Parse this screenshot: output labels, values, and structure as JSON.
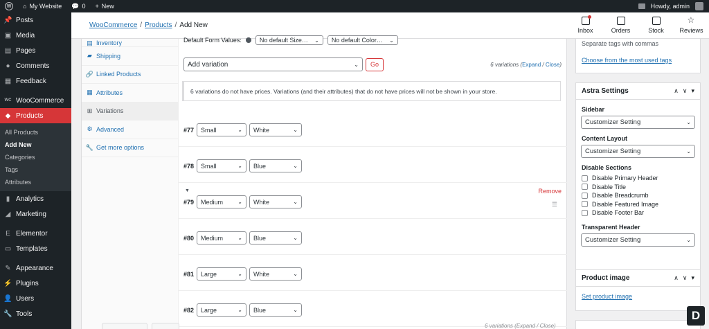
{
  "adminbar": {
    "site_name": "My Website",
    "comments_count": "0",
    "new_label": "New",
    "howdy": "Howdy, admin"
  },
  "sidebar": {
    "items_top": [
      {
        "label": "Posts",
        "icon": "pin-icon"
      },
      {
        "label": "Media",
        "icon": "media-icon"
      },
      {
        "label": "Pages",
        "icon": "pages-icon"
      },
      {
        "label": "Comments",
        "icon": "comments-icon"
      },
      {
        "label": "Feedback",
        "icon": "feedback-icon"
      }
    ],
    "woocommerce": "WooCommerce",
    "products": "Products",
    "submenu": [
      "All Products",
      "Add New",
      "Categories",
      "Tags",
      "Attributes"
    ],
    "items_bottom": [
      {
        "label": "Analytics",
        "icon": "analytics-icon"
      },
      {
        "label": "Marketing",
        "icon": "marketing-icon"
      },
      {
        "label": "Elementor",
        "icon": "elementor-icon"
      },
      {
        "label": "Templates",
        "icon": "templates-icon"
      },
      {
        "label": "Appearance",
        "icon": "appearance-icon"
      },
      {
        "label": "Plugins",
        "icon": "plugins-icon"
      },
      {
        "label": "Users",
        "icon": "users-icon"
      },
      {
        "label": "Tools",
        "icon": "tools-icon"
      }
    ]
  },
  "header": {
    "breadcrumb": [
      "WooCommerce",
      "Products",
      "Add New"
    ],
    "nav": [
      "Inbox",
      "Orders",
      "Stock",
      "Reviews"
    ]
  },
  "tabs": {
    "partial": "Inventory",
    "items": [
      "Shipping",
      "Linked Products",
      "Attributes",
      "Variations",
      "Advanced",
      "Get more options"
    ]
  },
  "variations": {
    "default_label": "Default Form Values:",
    "default_size": "No default Size…",
    "default_color": "No default Color…",
    "add_variation": "Add variation",
    "go": "Go",
    "count_text": "6 variations (",
    "expand": "Expand",
    "slash": " / ",
    "close": "Close",
    "close_paren": ")",
    "notice": "6 variations do not have prices. Variations (and their attributes) that do not have prices will not be shown in your store.",
    "remove": "Remove",
    "rows": [
      {
        "num": "#77",
        "size": "Small",
        "color": "White"
      },
      {
        "num": "#78",
        "size": "Small",
        "color": "Blue"
      },
      {
        "num": "#79",
        "size": "Medium",
        "color": "White"
      },
      {
        "num": "#80",
        "size": "Medium",
        "color": "Blue"
      },
      {
        "num": "#81",
        "size": "Large",
        "color": "White"
      },
      {
        "num": "#82",
        "size": "Large",
        "color": "Blue"
      }
    ],
    "bottom_count": "6 variations (Expand / Close)"
  },
  "tags_box": {
    "hint": "Separate tags with commas",
    "link": "Choose from the most used tags"
  },
  "astra": {
    "title": "Astra Settings",
    "sidebar_label": "Sidebar",
    "sidebar_value": "Customizer Setting",
    "layout_label": "Content Layout",
    "layout_value": "Customizer Setting",
    "disable_label": "Disable Sections",
    "disable_items": [
      "Disable Primary Header",
      "Disable Title",
      "Disable Breadcrumb",
      "Disable Featured Image",
      "Disable Footer Bar"
    ],
    "transparent_label": "Transparent Header",
    "transparent_value": "Customizer Setting"
  },
  "product_image": {
    "title": "Product image",
    "link": "Set product image"
  },
  "badge": "D"
}
